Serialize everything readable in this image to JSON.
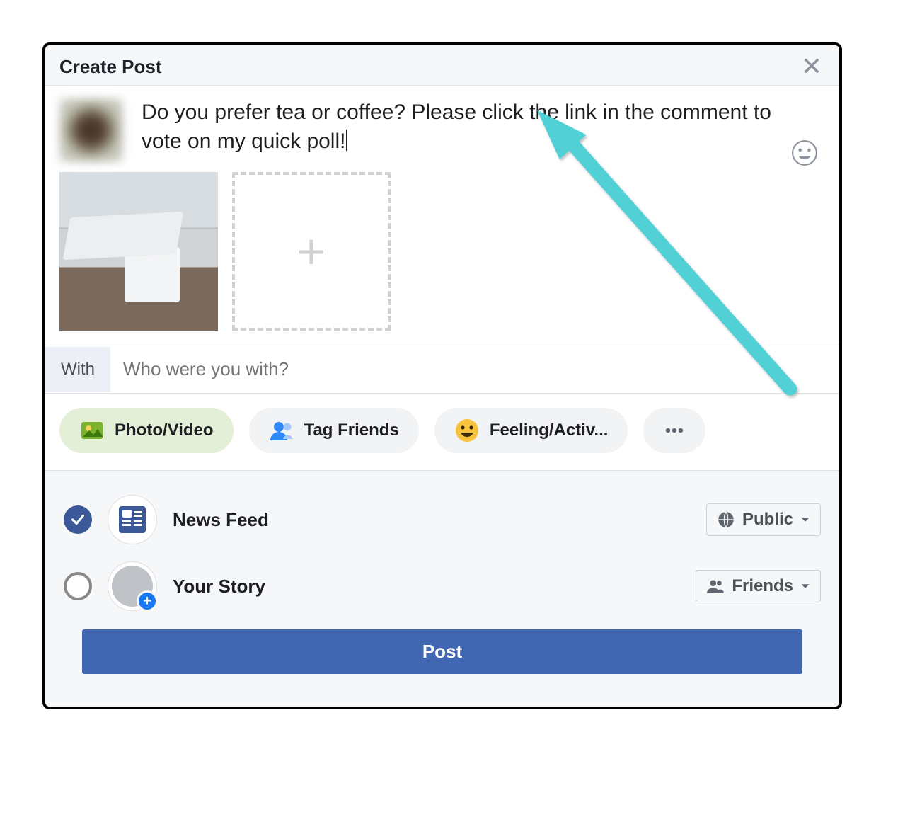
{
  "header": {
    "title": "Create Post"
  },
  "compose": {
    "text": "Do you prefer tea or coffee? Please click the link in the comment to vote on my quick poll!"
  },
  "with": {
    "label": "With",
    "placeholder": "Who were you with?"
  },
  "pills": {
    "photo": "Photo/Video",
    "tag": "Tag Friends",
    "feeling": "Feeling/Activ..."
  },
  "destinations": {
    "newsfeed": {
      "label": "News Feed",
      "privacy": "Public"
    },
    "story": {
      "label": "Your Story",
      "privacy": "Friends"
    }
  },
  "post_button": "Post"
}
